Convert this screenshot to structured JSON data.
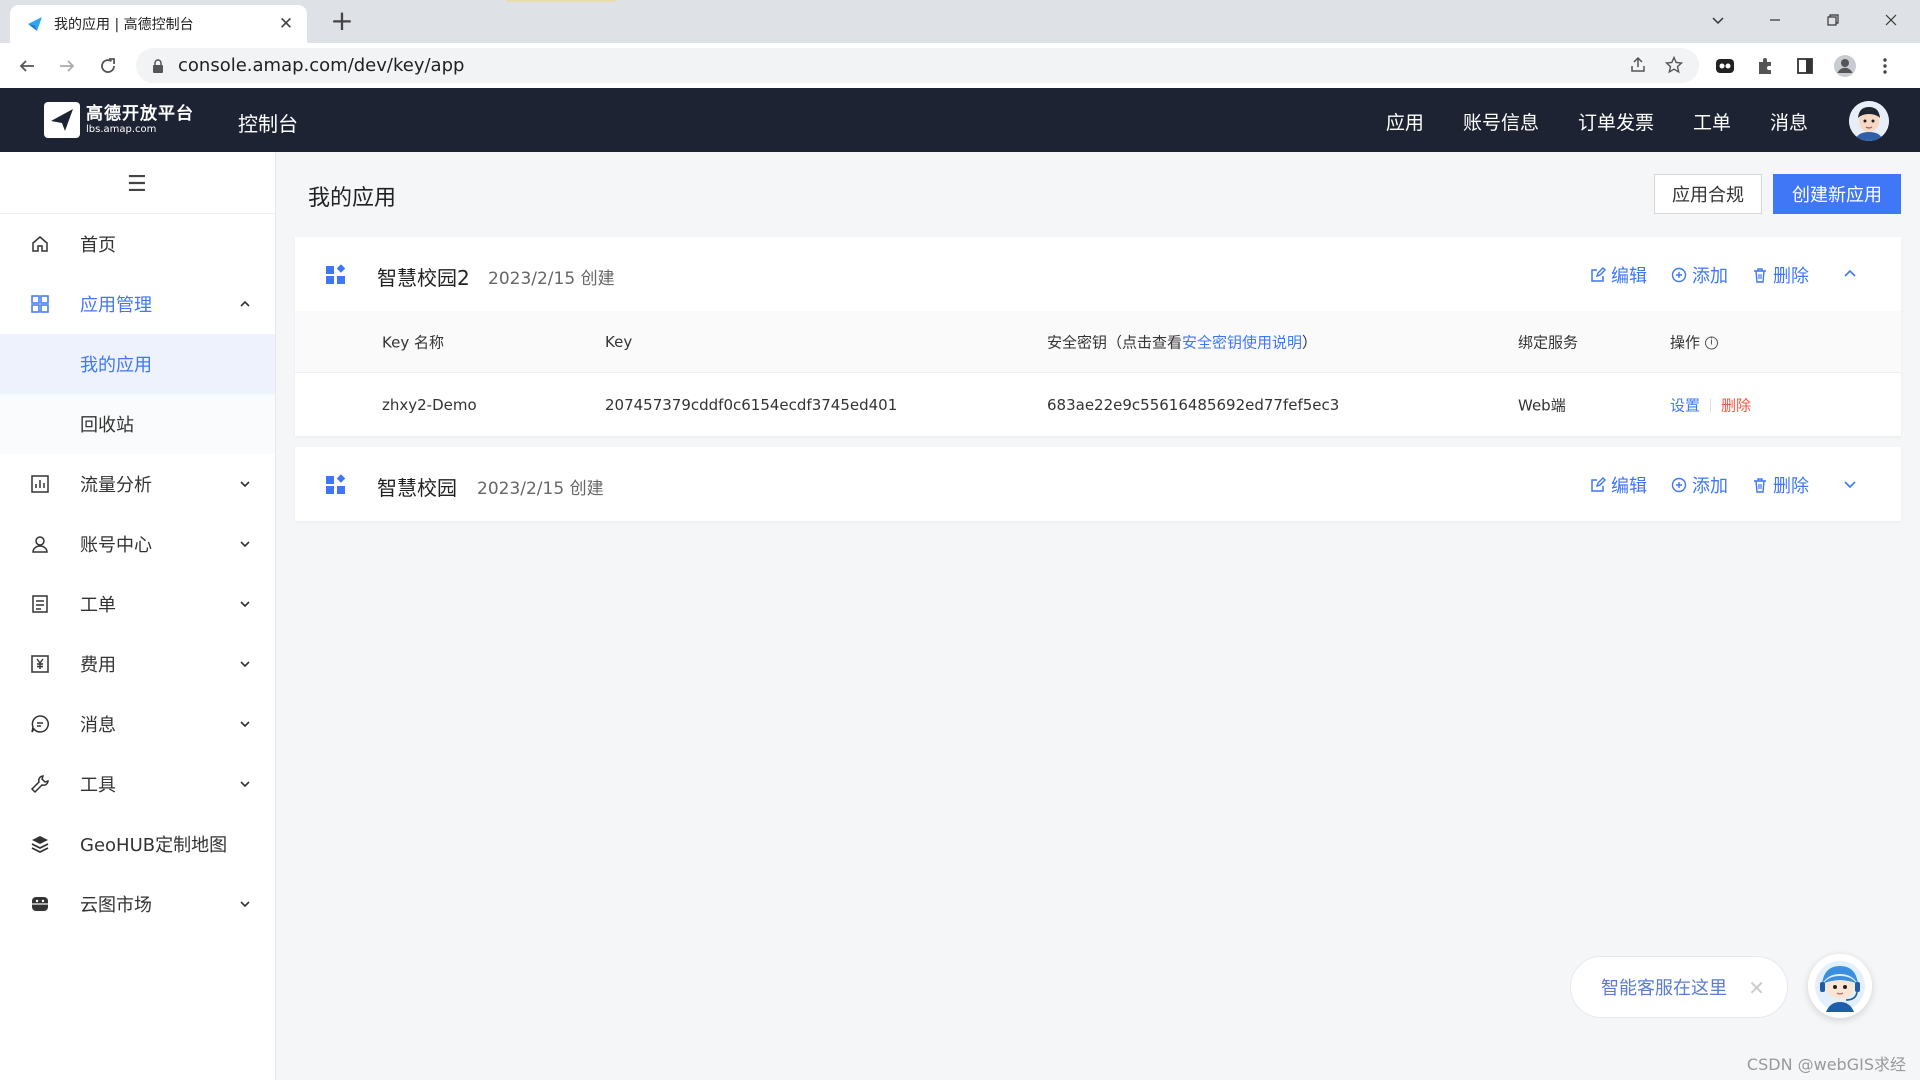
{
  "browser": {
    "tab_title": "我的应用 | 高德控制台",
    "url": "console.amap.com/dev/key/app"
  },
  "header": {
    "logo_line1": "高德开放平台",
    "logo_line2": "lbs.amap.com",
    "console_label": "控制台",
    "nav": [
      "应用",
      "账号信息",
      "订单发票",
      "工单",
      "消息"
    ]
  },
  "sidebar": {
    "items": [
      {
        "label": "首页",
        "icon": "home-icon"
      },
      {
        "label": "应用管理",
        "icon": "grid-icon"
      },
      {
        "label": "流量分析",
        "icon": "chart-icon"
      },
      {
        "label": "账号中心",
        "icon": "user-icon"
      },
      {
        "label": "工单",
        "icon": "ticket-icon"
      },
      {
        "label": "费用",
        "icon": "yuan-icon"
      },
      {
        "label": "消息",
        "icon": "message-icon"
      },
      {
        "label": "工具",
        "icon": "wrench-icon"
      },
      {
        "label": "GeoHUB定制地图",
        "icon": "layers-icon"
      },
      {
        "label": "云图市场",
        "icon": "store-icon"
      }
    ],
    "sub_items": [
      "我的应用",
      "回收站"
    ]
  },
  "main": {
    "title": "我的应用",
    "compliance_btn": "应用合规",
    "create_btn": "创建新应用",
    "actions": {
      "edit": "编辑",
      "add": "添加",
      "delete": "删除"
    },
    "apps": [
      {
        "name": "智慧校园2",
        "created": "2023/2/15 创建",
        "table": {
          "headers": {
            "key_name": "Key 名称",
            "key": "Key",
            "secret_prefix": "安全密钥（点击查看",
            "secret_link": "安全密钥使用说明",
            "secret_suffix": "）",
            "service": "绑定服务",
            "ops": "操作"
          },
          "rows": [
            {
              "key_name": "zhxy2-Demo",
              "key": "207457379cddf0c6154ecdf3745ed401",
              "secret": "683ae22e9c55616485692ed77fef5ec3",
              "service": "Web端",
              "op_settings": "设置",
              "op_delete": "删除"
            }
          ]
        }
      },
      {
        "name": "智慧校园",
        "created": "2023/2/15 创建"
      }
    ]
  },
  "chat": {
    "label": "智能客服在这里"
  },
  "watermark": "CSDN @webGIS求经",
  "colors": {
    "primary": "#3f77f6",
    "header_bg": "#1e2333",
    "danger": "#f5553d"
  }
}
